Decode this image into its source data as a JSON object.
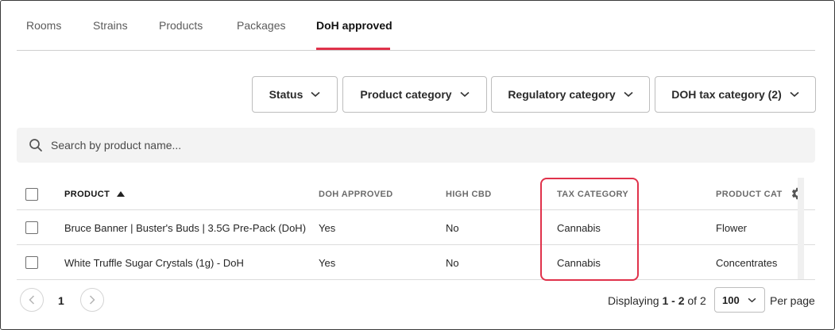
{
  "tabs": [
    {
      "label": "Rooms"
    },
    {
      "label": "Strains"
    },
    {
      "label": "Products"
    },
    {
      "label": "Packages"
    },
    {
      "label": "DoH approved"
    }
  ],
  "active_tab": "DoH approved",
  "filters": [
    {
      "label": "Status"
    },
    {
      "label": "Product category"
    },
    {
      "label": "Regulatory category"
    },
    {
      "label": "DOH tax category (2)"
    }
  ],
  "search": {
    "placeholder": "Search by product name..."
  },
  "table": {
    "columns": [
      "PRODUCT",
      "DOH APPROVED",
      "HIGH CBD",
      "TAX CATEGORY",
      "PRODUCT CAT"
    ],
    "sort_column": "PRODUCT",
    "sort_direction": "ascending",
    "rows": [
      [
        "Bruce Banner | Buster's Buds | 3.5G Pre-Pack (DoH)",
        "Yes",
        "No",
        "Cannabis",
        "Flower"
      ],
      [
        "White Truffle Sugar Crystals (1g) - DoH",
        "Yes",
        "No",
        "Cannabis",
        "Concentrates"
      ]
    ]
  },
  "pagination": {
    "current_page": "1",
    "displaying_prefix": "Displaying ",
    "displaying_range": "1 - 2",
    "displaying_suffix": " of 2",
    "per_page_value": "100",
    "per_page_label": "Per page"
  },
  "colors": {
    "accent": "#e0324b",
    "search_bg": "#f3f3f3"
  },
  "icons": {
    "search": "search-icon",
    "sort": "sort-ascending-icon",
    "settings": "gear-icon",
    "prev": "chevron-left-icon",
    "next": "chevron-right-icon"
  }
}
